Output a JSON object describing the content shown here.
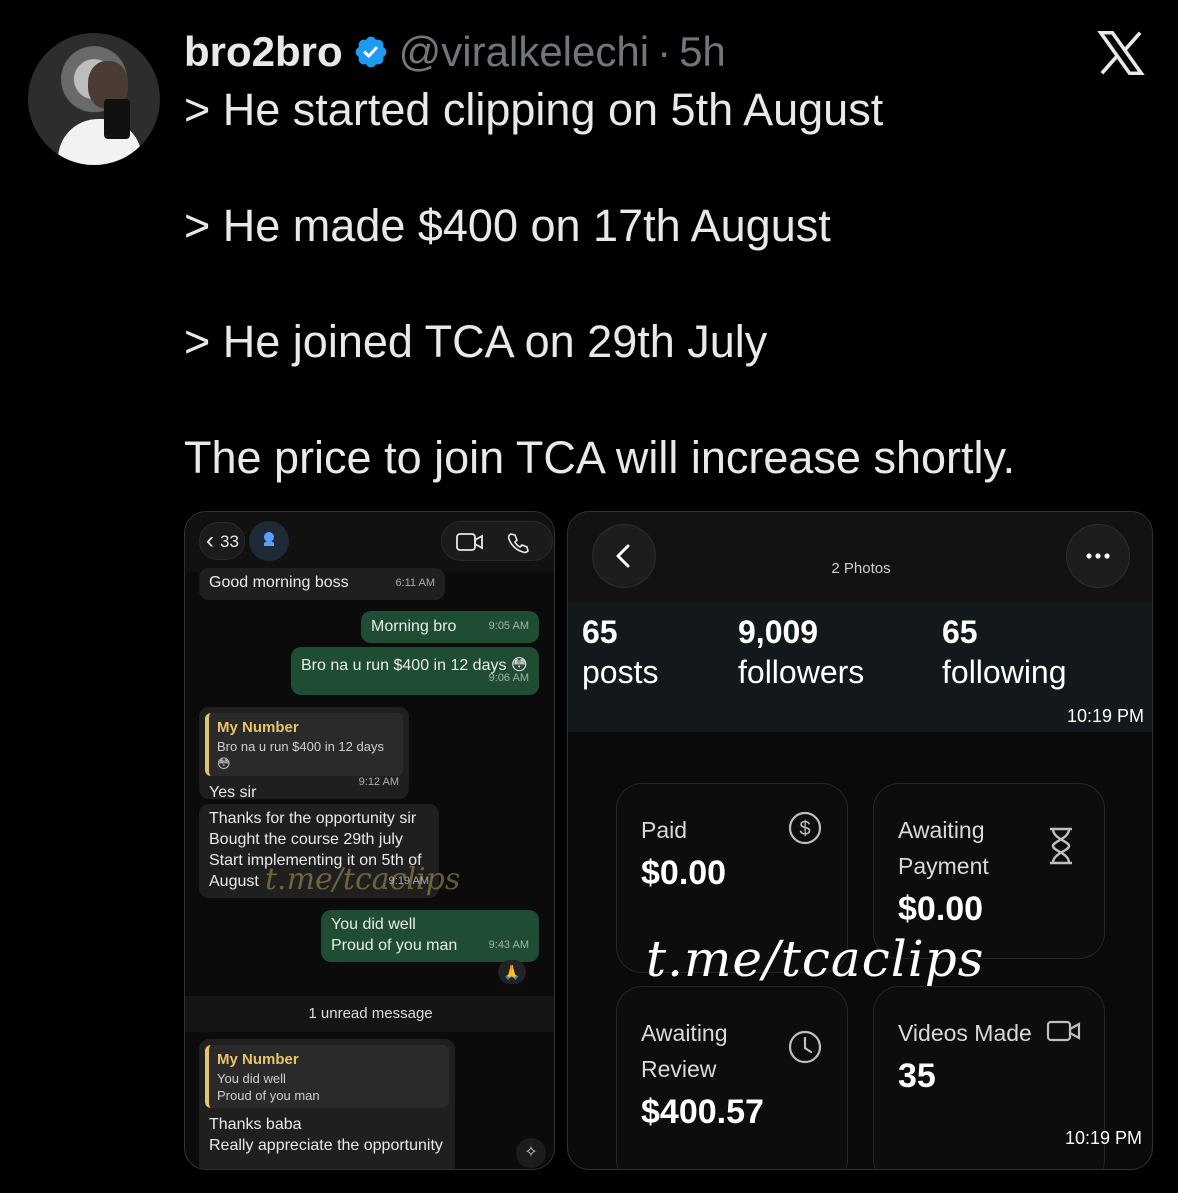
{
  "tweet": {
    "display_name": "bro2bro",
    "handle": "@viralkelechi",
    "separator": "·",
    "time_ago": "5h",
    "lines": [
      "> He started clipping on 5th August",
      "> He made $400 on 17th August",
      "> He joined TCA on 29th July",
      "The price to join TCA will increase shortly."
    ]
  },
  "chat": {
    "back_count": "33",
    "messages": [
      {
        "text": "Good morning boss",
        "time": "6:11 AM"
      },
      {
        "text": "Morning bro",
        "time": "9:05 AM"
      },
      {
        "text": "Bro na u run $400 in 12 days 😳",
        "time": "9:06 AM"
      },
      {
        "quote_title": "My Number",
        "quote_body": "Bro na u run $400 in 12 days 😳",
        "text": "Yes sir",
        "time": "9:12 AM"
      },
      {
        "lines": [
          "Thanks for the opportunity sir",
          "Bought the course 29th july",
          "Start implementing it on 5th of",
          "August"
        ],
        "time": "9:19 AM"
      },
      {
        "lines": [
          "You did well",
          "Proud of you man"
        ],
        "time": "9:43 AM"
      },
      {
        "quote_title": "My Number",
        "quote_lines": [
          "You did well",
          "Proud of you man"
        ],
        "lines": [
          "Thanks baba",
          "Really appreciate the opportunity"
        ]
      }
    ],
    "reaction": "🙏",
    "unread_label": "1 unread message",
    "watermark": "t.me/tcaclips"
  },
  "stats_panel": {
    "title": "2 Photos",
    "profile": {
      "posts_count": "65",
      "posts_label": "posts",
      "followers_count": "9,009",
      "followers_label": "followers",
      "following_count": "65",
      "following_label": "following"
    },
    "timestamp": "10:19 PM",
    "cards": {
      "paid_label": "Paid",
      "paid_value": "$0.00",
      "awaiting_payment_label_1": "Awaiting",
      "awaiting_payment_label_2": "Payment",
      "awaiting_payment_value": "$0.00",
      "awaiting_review_label_1": "Awaiting",
      "awaiting_review_label_2": "Review",
      "awaiting_review_value": "$400.57",
      "videos_made_label": "Videos Made",
      "videos_made_value": "35"
    },
    "watermark": "t.me/tcaclips",
    "bottom_timestamp": "10:19 PM"
  },
  "colors": {
    "background": "#000000",
    "verified": "#1d9bf0",
    "muted": "#71767b",
    "chat_outgoing": "#1e4d34",
    "quote_accent": "#e7c46a"
  },
  "icons": [
    "x-logo-icon",
    "verified-badge-icon",
    "video-call-icon",
    "phone-icon",
    "back-arrow-icon",
    "more-icon",
    "dollar-icon",
    "hourglass-icon",
    "clock-icon",
    "video-camera-icon"
  ]
}
